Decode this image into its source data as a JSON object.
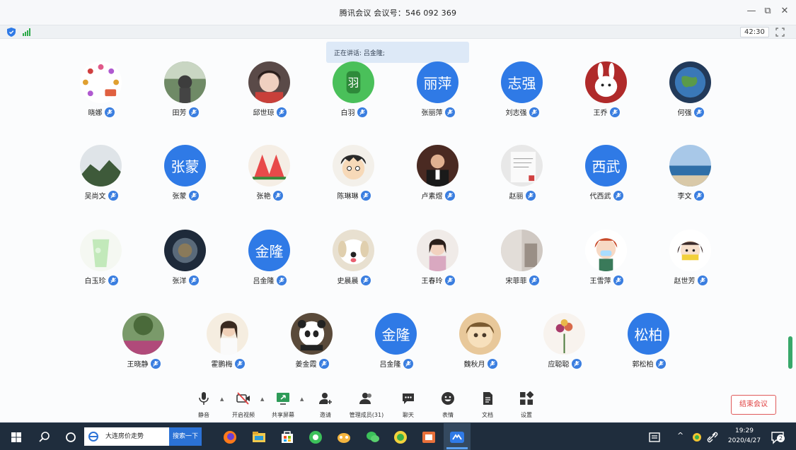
{
  "window": {
    "title": "腾讯会议 会议号：546 092 369",
    "minimize": "—",
    "restore": "⧉",
    "close": "✕"
  },
  "status": {
    "timer": "42:30"
  },
  "speaking": {
    "text": "正在讲话: 吕金隆;"
  },
  "participants": [
    {
      "name": "晓娜",
      "avatar_text": "",
      "avatar_style": "butterflies"
    },
    {
      "name": "田芳",
      "avatar_text": "",
      "avatar_style": "photo-green"
    },
    {
      "name": "邱世琼",
      "avatar_text": "",
      "avatar_style": "photo-child"
    },
    {
      "name": "白羽",
      "avatar_text": "",
      "avatar_style": "green-badge"
    },
    {
      "name": "张丽萍",
      "avatar_text": "丽萍",
      "avatar_style": "text"
    },
    {
      "name": "刘志强",
      "avatar_text": "志强",
      "avatar_style": "text"
    },
    {
      "name": "王乔",
      "avatar_text": "",
      "avatar_style": "bunny"
    },
    {
      "name": "何强",
      "avatar_text": "",
      "avatar_style": "earth"
    },
    {
      "name": "吴尚文",
      "avatar_text": "",
      "avatar_style": "mountain"
    },
    {
      "name": "张蒙",
      "avatar_text": "张蒙",
      "avatar_style": "text"
    },
    {
      "name": "张艳",
      "avatar_text": "",
      "avatar_style": "watermelon"
    },
    {
      "name": "陈琳琳",
      "avatar_text": "",
      "avatar_style": "cartoon"
    },
    {
      "name": "卢素煜",
      "avatar_text": "",
      "avatar_style": "photo-man"
    },
    {
      "name": "赵丽",
      "avatar_text": "",
      "avatar_style": "paper"
    },
    {
      "name": "代西武",
      "avatar_text": "西武",
      "avatar_style": "text"
    },
    {
      "name": "李文",
      "avatar_text": "",
      "avatar_style": "sea"
    },
    {
      "name": "白玉珍",
      "avatar_text": "",
      "avatar_style": "glass"
    },
    {
      "name": "张洋",
      "avatar_text": "",
      "avatar_style": "dark-circle"
    },
    {
      "name": "吕金隆",
      "avatar_text": "金隆",
      "avatar_style": "text"
    },
    {
      "name": "史晨晨",
      "avatar_text": "",
      "avatar_style": "dog"
    },
    {
      "name": "王春玲",
      "avatar_text": "",
      "avatar_style": "photo-girl"
    },
    {
      "name": "宋菲菲",
      "avatar_text": "",
      "avatar_style": "room"
    },
    {
      "name": "王雪萍",
      "avatar_text": "",
      "avatar_style": "girl-mask"
    },
    {
      "name": "赵世芳",
      "avatar_text": "",
      "avatar_style": "girl-cartoon"
    },
    {
      "name": "王晓静",
      "avatar_text": "",
      "avatar_style": "garden"
    },
    {
      "name": "霍鹏梅",
      "avatar_text": "",
      "avatar_style": "photo-woman"
    },
    {
      "name": "姜金霞",
      "avatar_text": "",
      "avatar_style": "panda"
    },
    {
      "name": "吕金隆",
      "avatar_text": "金隆",
      "avatar_style": "text"
    },
    {
      "name": "魏秋月",
      "avatar_text": "",
      "avatar_style": "cartoon-face"
    },
    {
      "name": "应聪聪",
      "avatar_text": "",
      "avatar_style": "flowers"
    },
    {
      "name": "郭松柏",
      "avatar_text": "松柏",
      "avatar_style": "text"
    }
  ],
  "toolbar": {
    "mute": "静音",
    "video": "开启视频",
    "share": "共享屏幕",
    "invite": "邀请",
    "members": "管理成员(31)",
    "chat": "聊天",
    "reaction": "表情",
    "docs": "文档",
    "settings": "设置",
    "end": "结束会议"
  },
  "taskbar": {
    "search_text": "大连房价走势",
    "search_button": "搜索一下",
    "time": "19:29",
    "date": "2020/4/27",
    "notif_count": "2"
  },
  "colors": {
    "accent": "#2f7ae6",
    "end_red": "#e04040",
    "taskbar": "#1f2d3d"
  }
}
